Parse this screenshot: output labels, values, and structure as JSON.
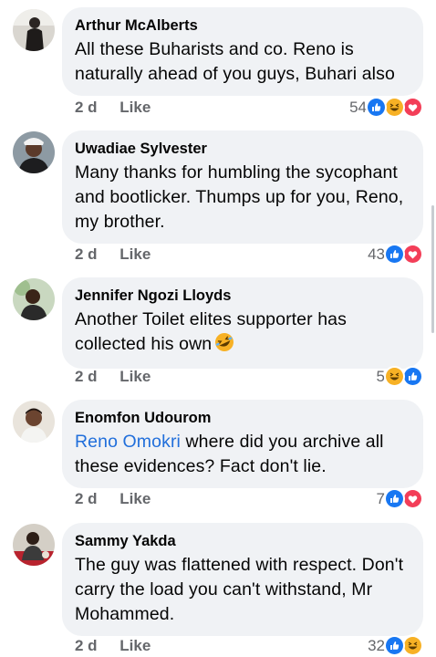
{
  "comments": [
    {
      "author": "Arthur McAlberts",
      "text": "All these Buharists and co. Reno is naturally ahead of you guys, Buhari also",
      "time": "2 d",
      "like_label": "Like",
      "reaction_count": "54",
      "reactions": [
        "like",
        "haha",
        "love"
      ]
    },
    {
      "author": "Uwadiae Sylvester",
      "text": "Many thanks for humbling the sycophant and bootlicker. Thumps up for you, Reno, my brother.",
      "time": "2 d",
      "like_label": "Like",
      "reaction_count": "43",
      "reactions": [
        "like",
        "love"
      ]
    },
    {
      "author": "Jennifer Ngozi Lloyds",
      "text": "Another Toilet elites supporter has collected his own",
      "inline_emoji": "rolling-laughing",
      "time": "2 d",
      "like_label": "Like",
      "reaction_count": "5",
      "reactions": [
        "haha",
        "like"
      ]
    },
    {
      "author": "Enomfon Udourom",
      "mention": "Reno Omokri",
      "text": " where did you archive all these evidences? Fact don't lie.",
      "time": "2 d",
      "like_label": "Like",
      "reaction_count": "7",
      "reactions": [
        "like",
        "love"
      ]
    },
    {
      "author": "Sammy Yakda",
      "text": "The guy was flattened with respect. Don't carry the load you can't withstand, Mr Mohammed.",
      "time": "2 d",
      "like_label": "Like",
      "reaction_count": "32",
      "reactions": [
        "like",
        "haha"
      ]
    }
  ],
  "colors": {
    "bubble": "#f0f2f5",
    "meta": "#65676b",
    "mention": "#216fdb",
    "like_reaction": "#1877f2",
    "love_reaction": "#f33e58",
    "haha_reaction": "#f7b125"
  }
}
